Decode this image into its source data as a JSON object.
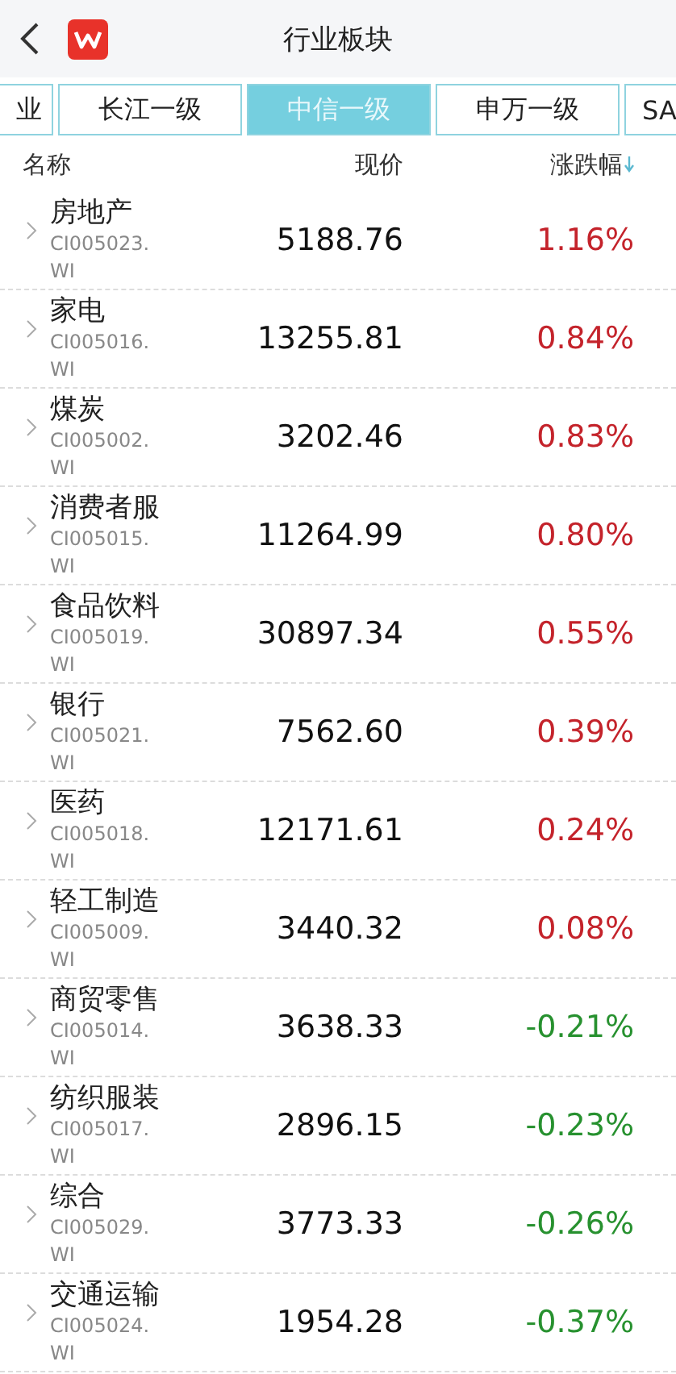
{
  "header": {
    "title": "行业板块"
  },
  "tabs": [
    {
      "label": "业",
      "selected": false,
      "kind": "cut-left"
    },
    {
      "label": "长江一级",
      "selected": false,
      "kind": "full"
    },
    {
      "label": "中信一级",
      "selected": true,
      "kind": "full"
    },
    {
      "label": "申万一级",
      "selected": false,
      "kind": "full"
    },
    {
      "label": "SA",
      "selected": false,
      "kind": "cut-right"
    }
  ],
  "columns": [
    "名称",
    "现价",
    "涨跌幅"
  ],
  "rows": [
    {
      "name": "房地产",
      "code": "CI005023.WI",
      "price": "5188.76",
      "change": "1.16%",
      "color": "#c4232b"
    },
    {
      "name": "家电",
      "code": "CI005016.WI",
      "price": "13255.81",
      "change": "0.84%",
      "color": "#c4232b"
    },
    {
      "name": "煤炭",
      "code": "CI005002.WI",
      "price": "3202.46",
      "change": "0.83%",
      "color": "#c4232b"
    },
    {
      "name": "消费者服",
      "code": "CI005015.WI",
      "price": "11264.99",
      "change": "0.80%",
      "color": "#c4232b"
    },
    {
      "name": "食品饮料",
      "code": "CI005019.WI",
      "price": "30897.34",
      "change": "0.55%",
      "color": "#c4232b"
    },
    {
      "name": "银行",
      "code": "CI005021.WI",
      "price": "7562.60",
      "change": "0.39%",
      "color": "#c4232b"
    },
    {
      "name": "医药",
      "code": "CI005018.WI",
      "price": "12171.61",
      "change": "0.24%",
      "color": "#c4232b"
    },
    {
      "name": "轻工制造",
      "code": "CI005009.WI",
      "price": "3440.32",
      "change": "0.08%",
      "color": "#c4232b"
    },
    {
      "name": "商贸零售",
      "code": "CI005014.WI",
      "price": "3638.33",
      "change": "-0.21%",
      "color": "#27912f"
    },
    {
      "name": "纺织服装",
      "code": "CI005017.WI",
      "price": "2896.15",
      "change": "-0.23%",
      "color": "#27912f"
    },
    {
      "name": "综合",
      "code": "CI005029.WI",
      "price": "3773.33",
      "change": "-0.26%",
      "color": "#27912f"
    },
    {
      "name": "交通运输",
      "code": "CI005024.WI",
      "price": "1954.28",
      "change": "-0.37%",
      "color": "#27912f"
    }
  ]
}
